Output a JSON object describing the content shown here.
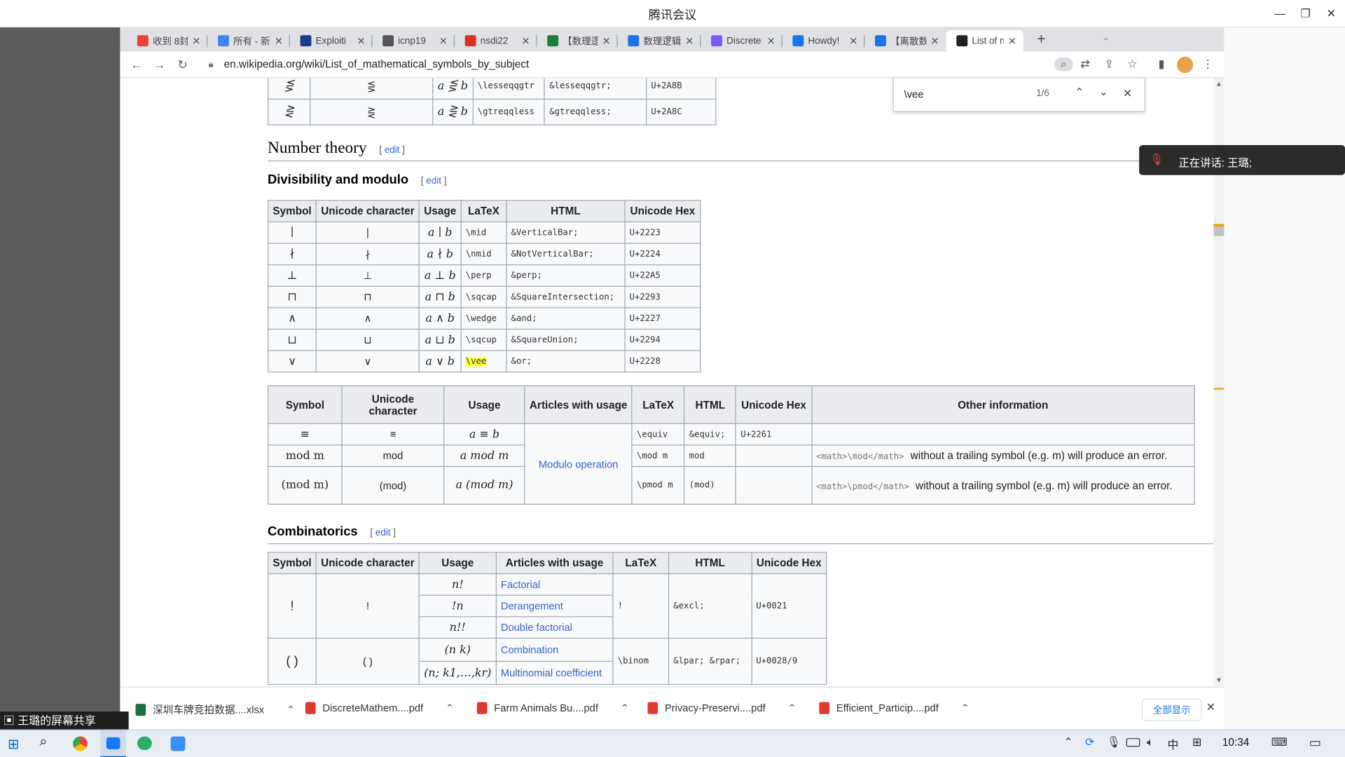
{
  "meeting": {
    "title": "腾讯会议",
    "speaking": "正在讲话: 王璐;",
    "share_label": "王璐的屏幕共享"
  },
  "browser": {
    "tabs": [
      {
        "label": "收到 8封",
        "color": "#ea4335"
      },
      {
        "label": "所有 - 新",
        "color": "#4285f4"
      },
      {
        "label": "Exploiti",
        "color": "#1a3e8c"
      },
      {
        "label": "icnp19",
        "color": "#555555"
      },
      {
        "label": "nsdi22",
        "color": "#d93025"
      },
      {
        "label": "【数理逻",
        "color": "#188038"
      },
      {
        "label": "数理逻辑",
        "color": "#1a73e8"
      },
      {
        "label": "Discrete",
        "color": "#7a5af8"
      },
      {
        "label": "Howdy!",
        "color": "#1a73e8"
      },
      {
        "label": "【离散数",
        "color": "#1a73e8"
      },
      {
        "label": "List of m",
        "color": "#202124"
      }
    ],
    "url": "en.wikipedia.org/wiki/List_of_mathematical_symbols_by_subject"
  },
  "find": {
    "query": "\\vee",
    "count": "1/6"
  },
  "page": {
    "prev_rows": [
      {
        "sym": "⋚",
        "uni": "⋚",
        "usage": "a ⋚ b",
        "latex": "\\lesseqqgtr",
        "html": "&lesseqqgtr;",
        "hex": "U+2A8B"
      },
      {
        "sym": "⋛",
        "uni": "⋛",
        "usage": "a ⋛ b",
        "latex": "\\gtreqqless",
        "html": "&gtreqqless;",
        "hex": "U+2A8C"
      }
    ],
    "section_number_theory": "Number theory",
    "edit": "edit",
    "subsection_div": "Divisibility and modulo",
    "div_headers": [
      "Symbol",
      "Unicode character",
      "Usage",
      "LaTeX",
      "HTML",
      "Unicode Hex"
    ],
    "div_rows": [
      {
        "sym": "∣",
        "uni": "∣",
        "usage": "a ∣ b",
        "latex": "\\mid",
        "html": "&VerticalBar;",
        "hex": "U+2223"
      },
      {
        "sym": "∤",
        "uni": "∤",
        "usage": "a ∤ b",
        "latex": "\\nmid",
        "html": "&NotVerticalBar;",
        "hex": "U+2224"
      },
      {
        "sym": "⊥",
        "uni": "⊥",
        "usage": "a ⊥ b",
        "latex": "\\perp",
        "html": "&perp;",
        "hex": "U+22A5"
      },
      {
        "sym": "⊓",
        "uni": "⊓",
        "usage": "a ⊓ b",
        "latex": "\\sqcap",
        "html": "&SquareIntersection;",
        "hex": "U+2293"
      },
      {
        "sym": "∧",
        "uni": "∧",
        "usage": "a ∧ b",
        "latex": "\\wedge",
        "html": "&and;",
        "hex": "U+2227"
      },
      {
        "sym": "⊔",
        "uni": "⊔",
        "usage": "a ⊔ b",
        "latex": "\\sqcup",
        "html": "&SquareUnion;",
        "hex": "U+2294"
      },
      {
        "sym": "∨",
        "uni": "∨",
        "usage": "a ∨ b",
        "latex": "\\vee",
        "html": "&or;",
        "hex": "U+2228"
      }
    ],
    "mod_headers": [
      "Symbol",
      "Unicode character",
      "Usage",
      "Articles with usage",
      "LaTeX",
      "HTML",
      "Unicode Hex",
      "Other information"
    ],
    "mod_rows": [
      {
        "sym": "≡",
        "uni": "≡",
        "usage": "a ≡ b",
        "latex": "\\equiv",
        "html": "&equiv;",
        "hex": "U+2261",
        "info": ""
      },
      {
        "sym": "mod m",
        "uni": "mod",
        "usage": "a   mod m",
        "latex": "\\mod m",
        "html": "mod",
        "hex": "",
        "info_code": "<math>\\mod</math>",
        "info": " without a trailing symbol (e.g. m) will produce an error."
      },
      {
        "sym": "(mod m)",
        "uni": "(mod)",
        "usage": "a   (mod m)",
        "latex": "\\pmod m",
        "html": "(mod)",
        "hex": "",
        "info_code": "<math>\\pmod</math>",
        "info": " without a trailing symbol (e.g. m) will produce an error."
      }
    ],
    "modulo_link": "Modulo operation",
    "section_comb": "Combinatorics",
    "comb_headers": [
      "Symbol",
      "Unicode character",
      "Usage",
      "Articles with usage",
      "LaTeX",
      "HTML",
      "Unicode Hex"
    ],
    "comb": {
      "excl": {
        "sym": "!",
        "uni": "!",
        "latex": "!",
        "html": "&excl;",
        "hex": "U+0021",
        "rows": [
          {
            "usage": "n!",
            "article": "Factorial"
          },
          {
            "usage": "!n",
            "article": "Derangement"
          },
          {
            "usage": "n!!",
            "article": "Double factorial"
          }
        ]
      },
      "paren": {
        "sym": "( )",
        "uni": "( )",
        "latex": "\\binom",
        "html": "&lpar;  &rpar;",
        "hex": "U+0028/9",
        "rows": [
          {
            "usage": "(n k)",
            "article": "Combination"
          },
          {
            "usage": "(n; k1,…,kr)",
            "article": "Multinomial coefficient"
          }
        ]
      }
    }
  },
  "downloads": {
    "items": [
      "深圳车牌竞拍数据....xlsx",
      "DiscreteMathem....pdf",
      "Farm Animals Bu....pdf",
      "Privacy-Preservi....pdf",
      "Efficient_Particip....pdf"
    ],
    "show_all": "全部显示"
  },
  "taskbar": {
    "time": "10:34",
    "ime": "中"
  }
}
